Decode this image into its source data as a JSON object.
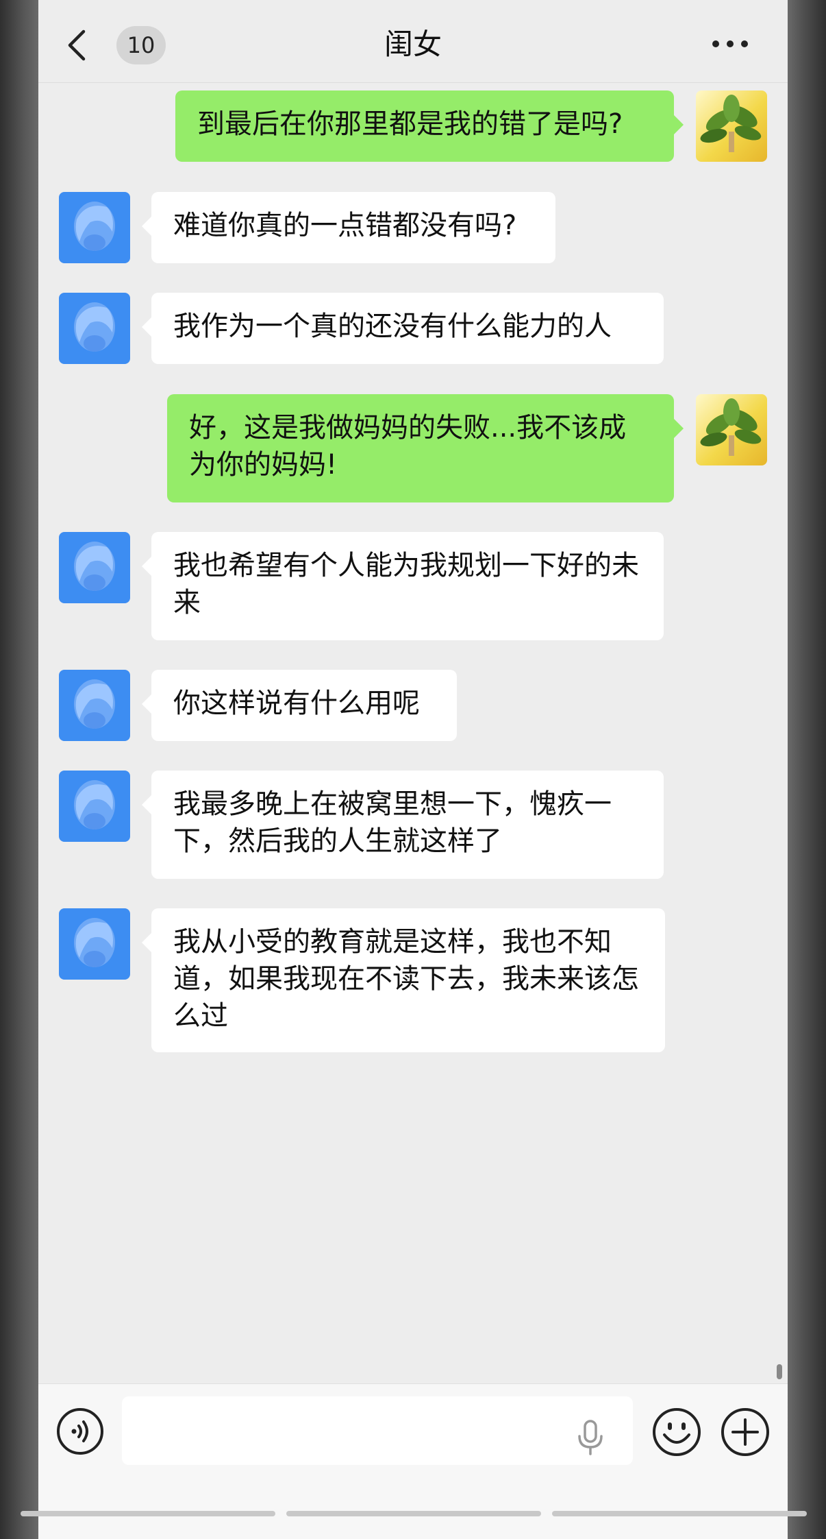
{
  "header": {
    "back_count": "10",
    "title": "闺女"
  },
  "messages": [
    {
      "side": "out",
      "avatar": "plant-avatar",
      "text": "到最后在你那里都是我的错了是吗?"
    },
    {
      "side": "in",
      "avatar": "blue-avatar",
      "text": "难道你真的一点错都没有吗?"
    },
    {
      "side": "in",
      "avatar": "blue-avatar",
      "text": "我作为一个真的还没有什么能力的人"
    },
    {
      "side": "out",
      "avatar": "plant-avatar",
      "text": "好，这是我做妈妈的失败...我不该成为你的妈妈!"
    },
    {
      "side": "in",
      "avatar": "blue-avatar",
      "text": "我也希望有个人能为我规划一下好的未来"
    },
    {
      "side": "in",
      "avatar": "blue-avatar",
      "text": "你这样说有什么用呢"
    },
    {
      "side": "in",
      "avatar": "blue-avatar",
      "text": "我最多晚上在被窝里想一下，愧疚一下，然后我的人生就这样了"
    },
    {
      "side": "in",
      "avatar": "blue-avatar",
      "text": "我从小受的教育就是这样，我也不知道，如果我现在不读下去，我未来该怎么过"
    }
  ],
  "input": {
    "value": "",
    "placeholder": ""
  },
  "icons": {
    "back": "chevron-left-icon",
    "more": "more-dots-icon",
    "voice": "voice-icon",
    "mic": "microphone-icon",
    "emoji": "emoji-icon",
    "plus": "plus-icon"
  },
  "colors": {
    "outgoing_bubble": "#95ec69",
    "incoming_bubble": "#ffffff",
    "background": "#ededed",
    "avatar_blue": "#3d8df2"
  }
}
